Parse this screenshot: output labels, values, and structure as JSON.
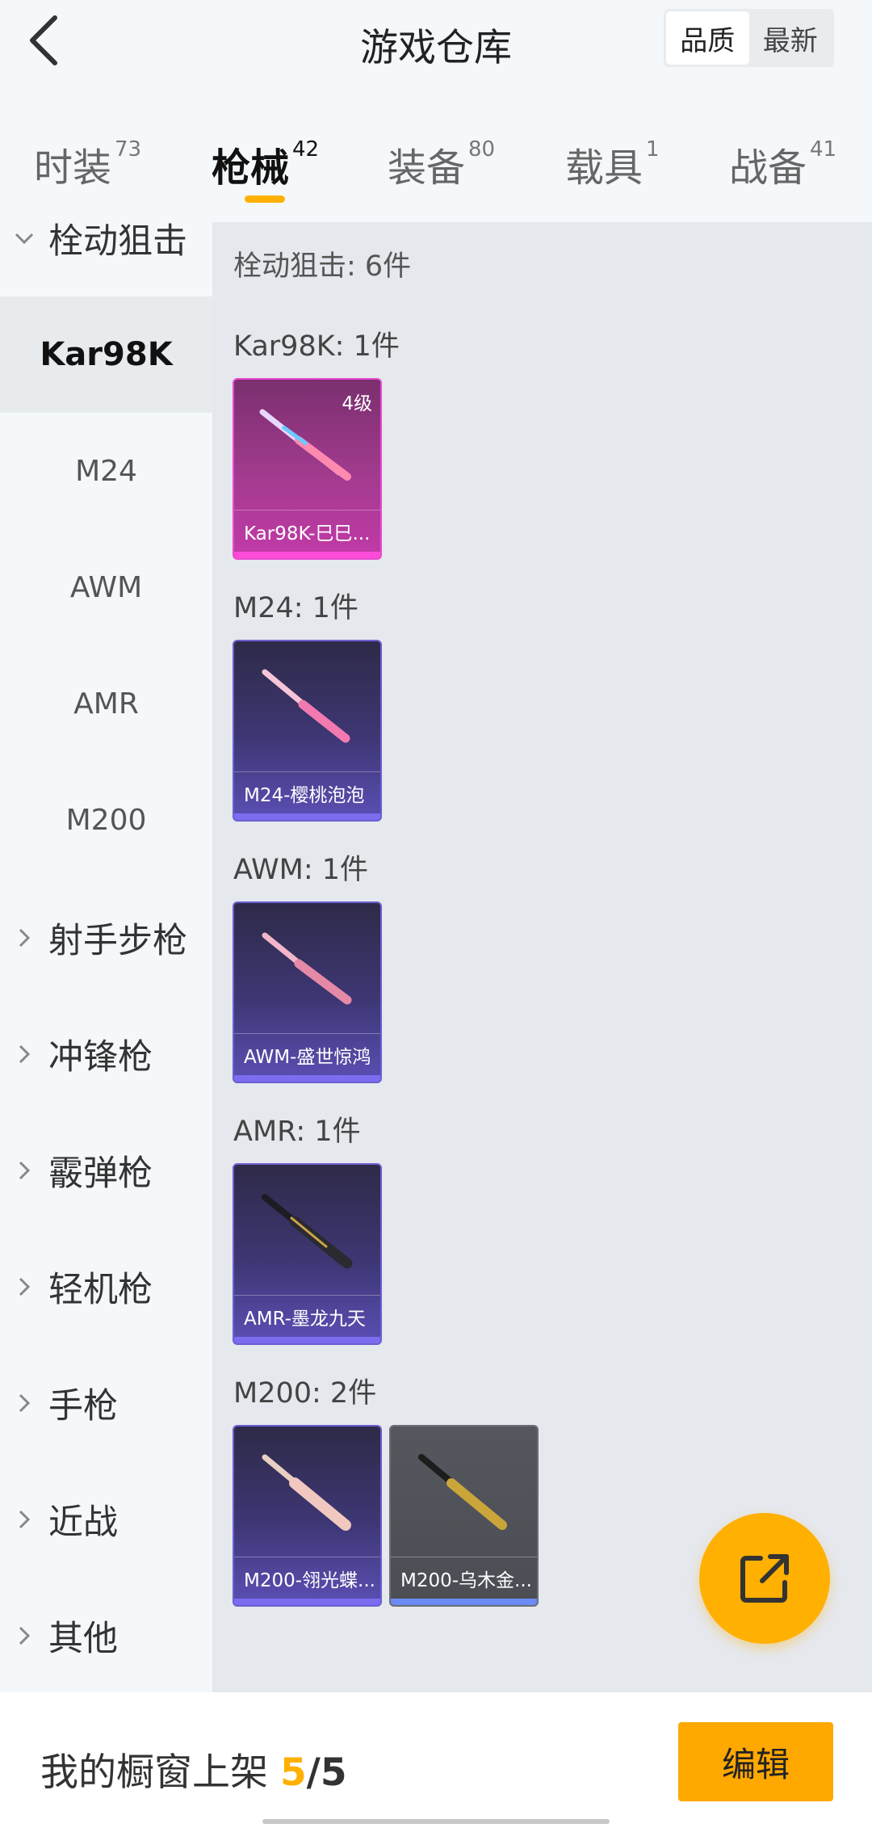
{
  "header": {
    "title": "游戏仓库",
    "sort": [
      "品质",
      "最新"
    ]
  },
  "tabs": [
    {
      "label": "时装",
      "count": "73"
    },
    {
      "label": "枪械",
      "count": "42"
    },
    {
      "label": "装备",
      "count": "80"
    },
    {
      "label": "载具",
      "count": "1"
    },
    {
      "label": "战备",
      "count": "41"
    }
  ],
  "sidebar": {
    "groups": [
      "栓动狙击",
      "射手步枪",
      "冲锋枪",
      "霰弹枪",
      "轻机枪",
      "手枪",
      "近战",
      "其他"
    ],
    "subs": [
      "Kar98K",
      "M24",
      "AWM",
      "AMR",
      "M200"
    ]
  },
  "content": {
    "total": "栓动狙击: 6件",
    "sections": [
      {
        "label": "Kar98K: 1件",
        "items": [
          {
            "name": "Kar98K-巳巳...",
            "level": "4级"
          }
        ]
      },
      {
        "label": "M24: 1件",
        "items": [
          {
            "name": "M24-樱桃泡泡"
          }
        ]
      },
      {
        "label": "AWM: 1件",
        "items": [
          {
            "name": "AWM-盛世惊鸿"
          }
        ]
      },
      {
        "label": "AMR: 1件",
        "items": [
          {
            "name": "AMR-墨龙九天"
          }
        ]
      },
      {
        "label": "M200: 2件",
        "items": [
          {
            "name": "M200-翎光蝶..."
          },
          {
            "name": "M200-乌木金..."
          }
        ]
      }
    ]
  },
  "footer": {
    "text": "我的橱窗上架",
    "current": "5",
    "sep": "/",
    "max": "5",
    "edit": "编辑"
  },
  "icons": {
    "back": "back-chevron-icon",
    "fab": "share-external-icon"
  },
  "colors": {
    "accent": "#ffb000",
    "edit_button": "#ffa800"
  }
}
